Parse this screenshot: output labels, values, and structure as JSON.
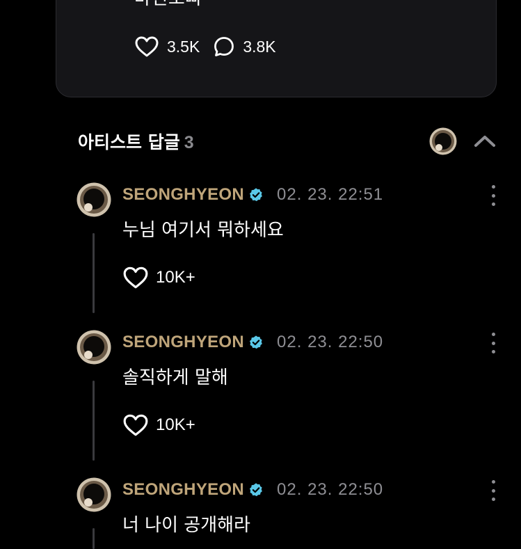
{
  "post": {
    "text": "마틴오빠",
    "likes": "3.5K",
    "comments": "3.8K"
  },
  "artist_replies": {
    "title": "아티스트 답글",
    "count": "3",
    "collapse_icon": "chevron-up-icon"
  },
  "replies": [
    {
      "author": "SEONGHYEON",
      "time": "02. 23. 22:51",
      "text": "누님 여기서 뭐하세요",
      "likes": "10K+"
    },
    {
      "author": "SEONGHYEON",
      "time": "02. 23. 22:50",
      "text": "솔직하게 말해",
      "likes": "10K+"
    },
    {
      "author": "SEONGHYEON",
      "time": "02. 23. 22:50",
      "text": "너 나이 공개해라",
      "likes": ""
    }
  ],
  "colors": {
    "background": "#000000",
    "card": "#151518",
    "author_name": "#bfa57a",
    "verified_badge": "#5ac8e8",
    "muted": "#8e8e93"
  }
}
